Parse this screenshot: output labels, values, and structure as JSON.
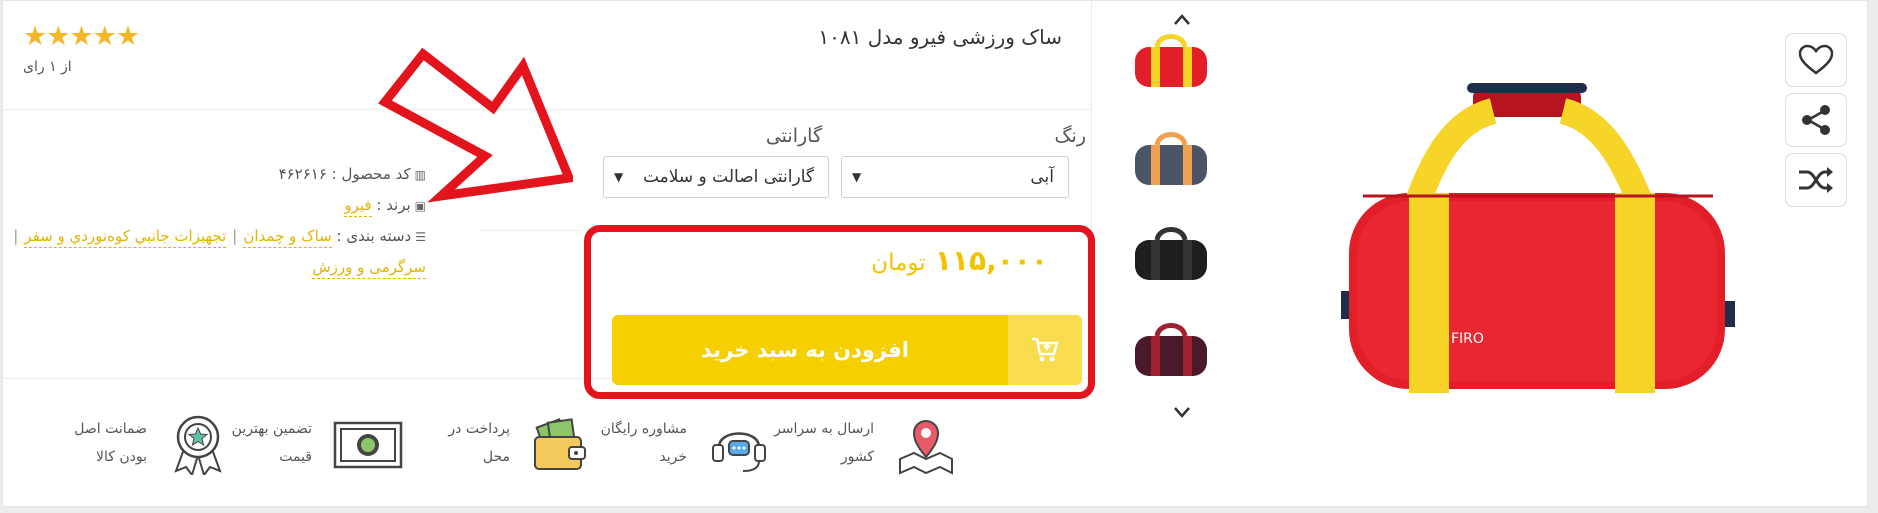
{
  "product": {
    "title": "ساک ورزشی فیرو مدل ۱۰۸۱",
    "rating_stars": "★★★★★",
    "rating_count": "از ۱ رای",
    "product_code": "کد محصول : ۴۶۲۶۱۶",
    "brand_label": "برند :",
    "brand": "فیرو",
    "category_label": "دسته بندی :",
    "categories": [
      "ساک و چمدان",
      "تجهيزات جانبي کوه‌نوردي و سفر",
      "سرگرمی و ورزش"
    ],
    "category_separator": "|"
  },
  "options": {
    "color_label": "رنگ",
    "color_value": "آبی",
    "warranty_label": "گارانتی",
    "warranty_value": "گارانتی اصالت و سلامت",
    "caret": "▼"
  },
  "purchase": {
    "price": "۱۱۵,۰۰۰",
    "currency": "تومان",
    "add_to_cart": "افزودن به سبد خرید"
  },
  "features": [
    {
      "line1": "ارسال به سراسر",
      "line2": "کشور",
      "icon": "map-pin-icon"
    },
    {
      "line1": "مشاوره رایگان",
      "line2": "خرید",
      "icon": "headset-icon"
    },
    {
      "line1": "پرداخت در",
      "line2": "محل",
      "icon": "wallet-icon"
    },
    {
      "line1": "تضمین بهترین",
      "line2": "قیمت",
      "icon": "banknote-icon"
    },
    {
      "line1": "ضمانت اصل",
      "line2": "بودن کالا",
      "icon": "award-badge-icon"
    }
  ],
  "bag": {
    "logo": "FIRO"
  },
  "colors": {
    "accent_yellow": "#f5cf00",
    "price_yellow": "#f3c200",
    "annotation_red": "#e3141c",
    "bag_red": "#e8202a",
    "strap_yellow": "#f7d428"
  }
}
